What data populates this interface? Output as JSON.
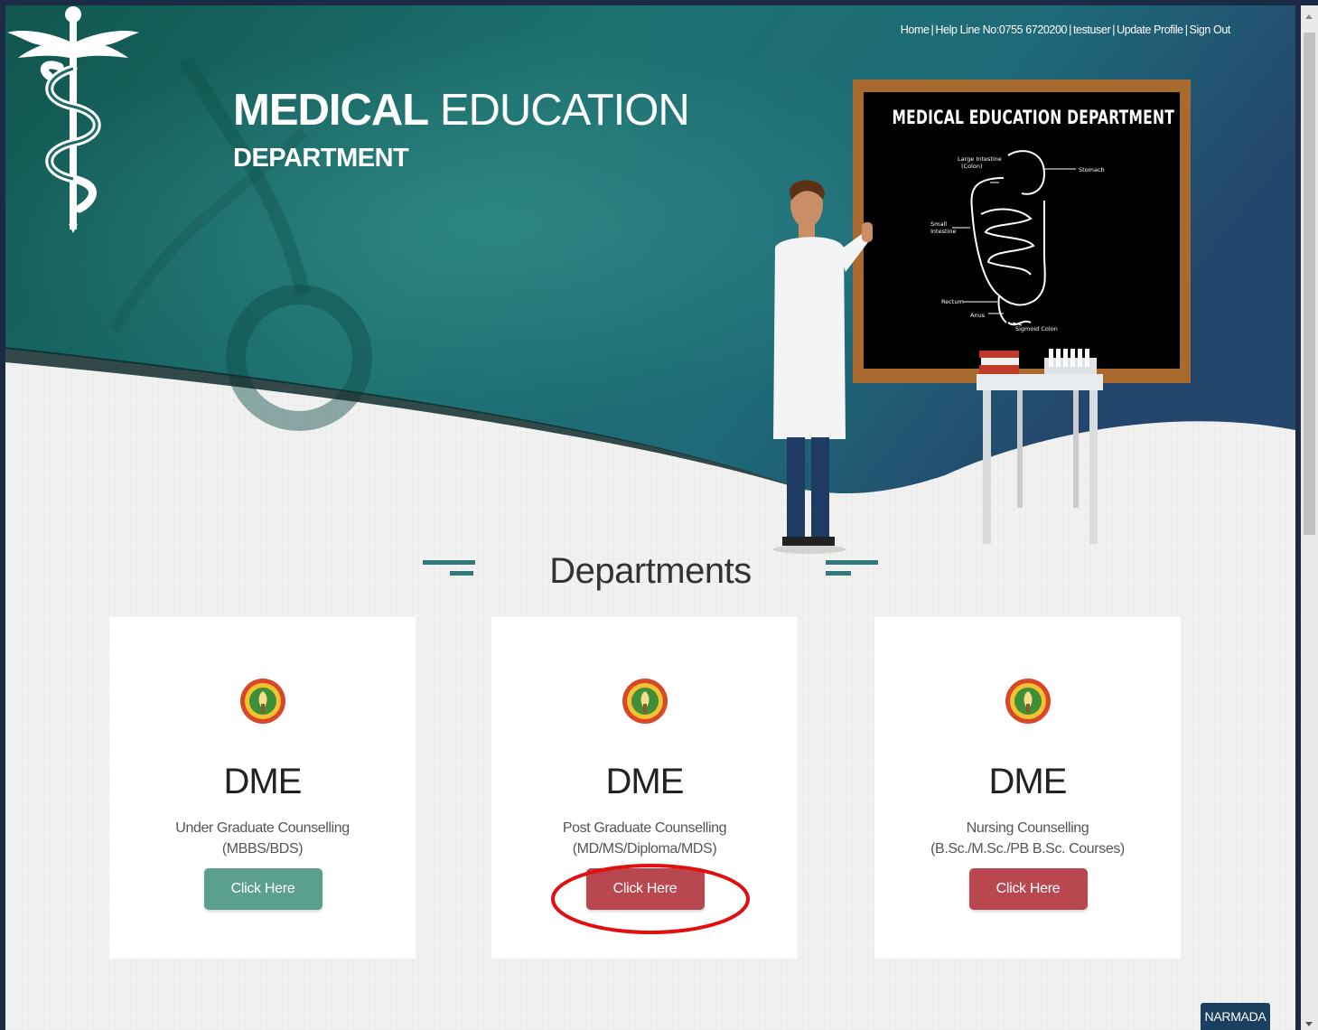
{
  "header": {
    "links": [
      "Home",
      "Help Line No:0755 6720200",
      "testuser",
      "Update Profile",
      "Sign Out"
    ],
    "brand_bold": "MEDICAL",
    "brand_light": "EDUCATION",
    "brand_sub": "DEPARTMENT",
    "board_title": "MEDICAL EDUCATION DEPARTMENT",
    "board_labels": [
      "Large Intestine (Colon)",
      "Stomach",
      "Small Intestine",
      "Rectum",
      "Anus",
      "Sigmoid Colon"
    ]
  },
  "section": {
    "title": "Departments"
  },
  "cards": [
    {
      "org": "DME",
      "desc_line1": "Under Graduate Counselling",
      "desc_line2": "(MBBS/BDS)",
      "button": "Click Here",
      "button_color": "#5aa08c"
    },
    {
      "org": "DME",
      "desc_line1": "Post Graduate Counselling",
      "desc_line2": "(MD/MS/Diploma/MDS)",
      "button": "Click Here",
      "button_color": "#b9474f"
    },
    {
      "org": "DME",
      "desc_line1": "Nursing Counselling",
      "desc_line2": "(B.Sc./M.Sc./PB B.Sc. Courses)",
      "button": "Click Here",
      "button_color": "#b9474f"
    }
  ],
  "footer_badge": "NARMADA",
  "colors": {
    "hero_teal": "#1f6c6a",
    "accent": "#2f7a7a",
    "highlight_ring": "#e01010"
  }
}
